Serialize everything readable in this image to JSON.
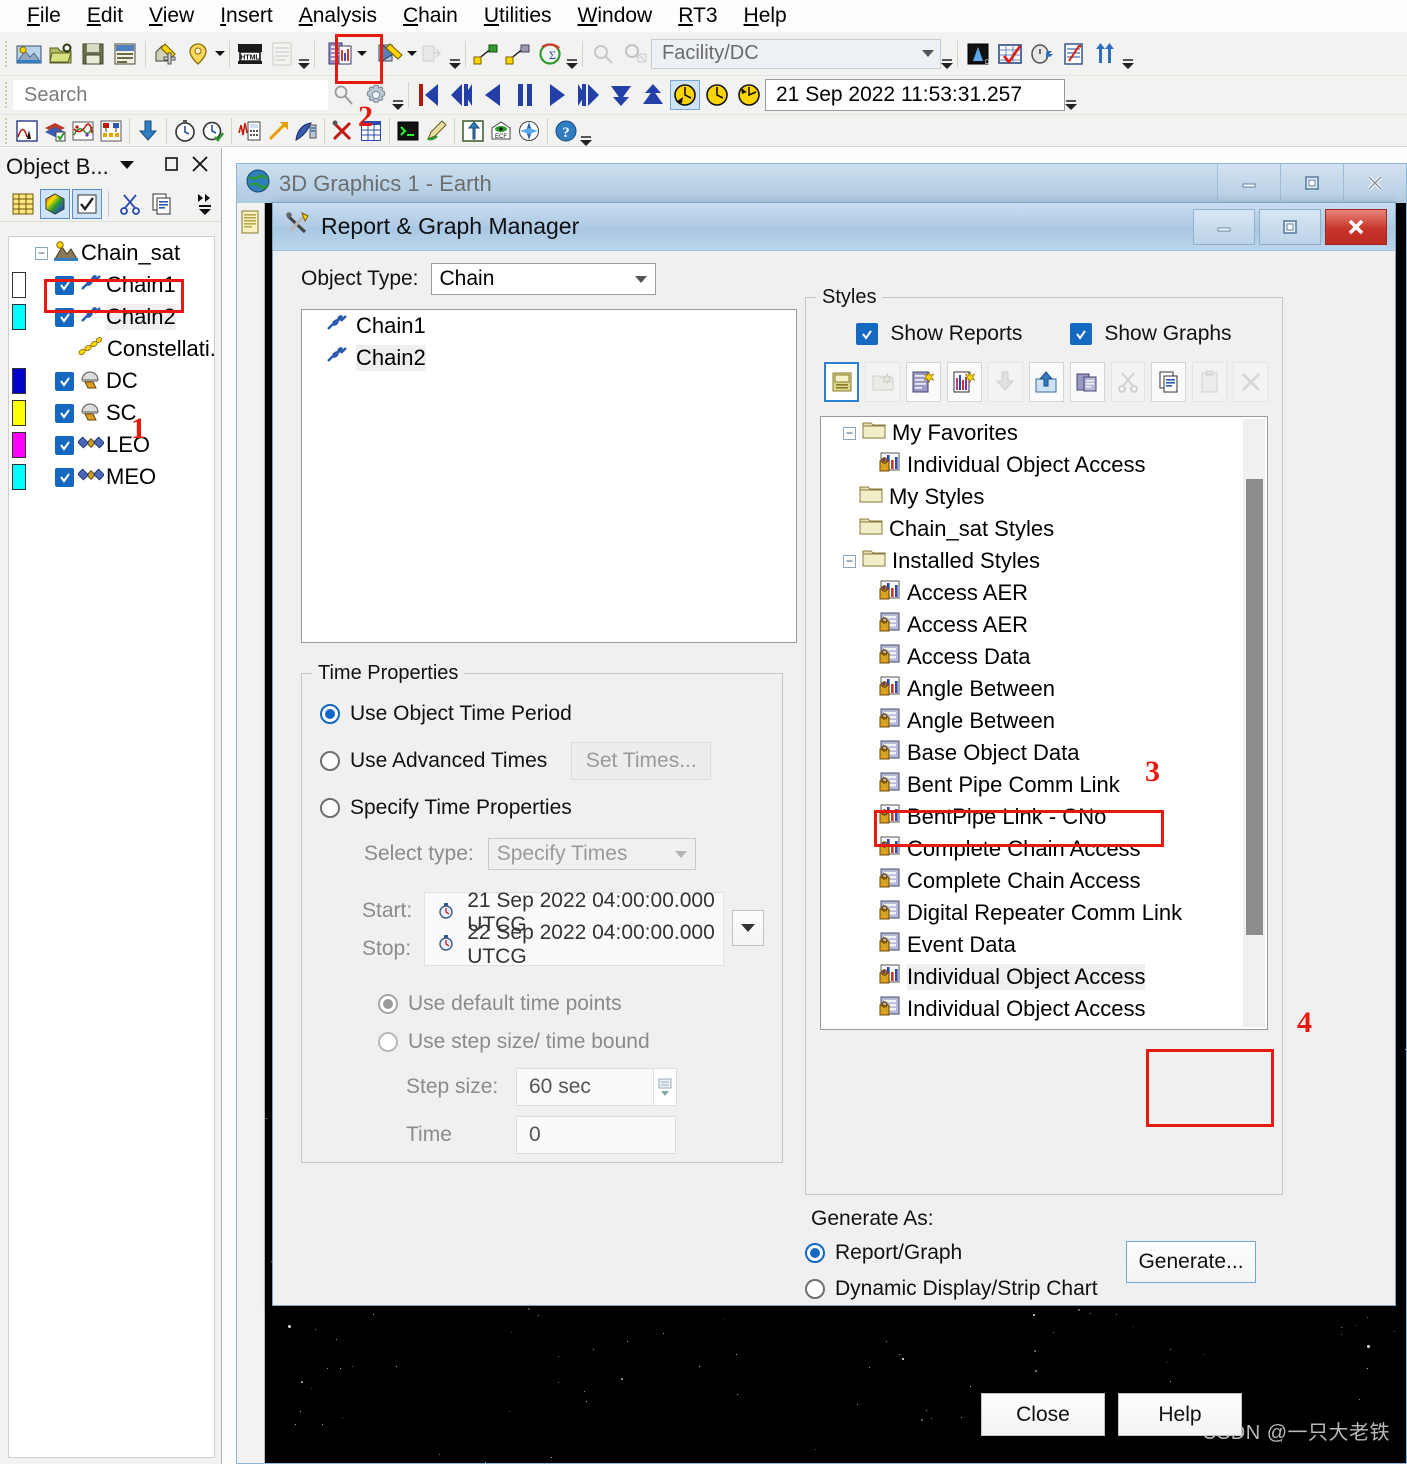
{
  "menubar": {
    "items": [
      {
        "label": "File",
        "accel": "F"
      },
      {
        "label": "Edit",
        "accel": "E"
      },
      {
        "label": "View",
        "accel": "V"
      },
      {
        "label": "Insert",
        "accel": "I"
      },
      {
        "label": "Analysis",
        "accel": "A"
      },
      {
        "label": "Chain",
        "accel": "C"
      },
      {
        "label": "Utilities",
        "accel": "U"
      },
      {
        "label": "Window",
        "accel": "W"
      },
      {
        "label": "RT3",
        "accel": "R"
      },
      {
        "label": "Help",
        "accel": "H"
      }
    ]
  },
  "toolbar": {
    "search_placeholder": "Search",
    "facility_combo_value": "Facility/DC",
    "time_value": "21 Sep 2022 11:53:31.257",
    "annotation_2": "2"
  },
  "object_browser": {
    "title": "Object B...",
    "tree": [
      {
        "label": "Chain_sat",
        "indent": 0,
        "checkbox": false,
        "icon": "scenario-icon",
        "swatch": null,
        "expander": "-"
      },
      {
        "label": "Chain1",
        "indent": 1,
        "checkbox": true,
        "icon": "chain-icon",
        "swatch": "#ffffff",
        "highlight": false
      },
      {
        "label": "Chain2",
        "indent": 1,
        "checkbox": true,
        "icon": "chain-icon",
        "swatch": "#00ffff",
        "highlight": true
      },
      {
        "label": "Constellati...",
        "indent": 1,
        "checkbox": false,
        "icon": "constellation-icon",
        "swatch": null
      },
      {
        "label": "DC",
        "indent": 1,
        "checkbox": true,
        "icon": "facility-icon",
        "swatch": "#0000cc"
      },
      {
        "label": "SC",
        "indent": 1,
        "checkbox": true,
        "icon": "facility-icon",
        "swatch": "#ffff00"
      },
      {
        "label": "LEO",
        "indent": 1,
        "checkbox": true,
        "icon": "satellite-icon",
        "swatch": "#ff00ff"
      },
      {
        "label": "MEO",
        "indent": 1,
        "checkbox": true,
        "icon": "satellite-icon",
        "swatch": "#00ffff"
      }
    ],
    "annotation_1": "1"
  },
  "graphics_window": {
    "title": "3D Graphics 1 - Earth",
    "watermark": "CSDN @一只大老铁"
  },
  "dialog": {
    "title": "Report & Graph Manager",
    "object_type_label": "Object Type:",
    "object_type_value": "Chain",
    "object_list": [
      {
        "label": "Chain1",
        "selected": false
      },
      {
        "label": "Chain2",
        "selected": true
      }
    ],
    "time_properties": {
      "legend": "Time Properties",
      "use_object_time_period": "Use Object Time Period",
      "use_advanced_times": "Use Advanced Times",
      "set_times_button": "Set Times...",
      "specify_time_properties": "Specify Time Properties",
      "select_type_label": "Select type:",
      "select_type_value": "Specify Times",
      "start_label": "Start:",
      "start_value": "21 Sep 2022 04:00:00.000 UTCG",
      "stop_label": "Stop:",
      "stop_value": "22 Sep 2022 04:00:00.000 UTCG",
      "use_default_time_points": "Use default time points",
      "use_step_size": "Use step size/ time bound",
      "step_size_label": "Step size:",
      "step_size_value": "60 sec",
      "time_label": "Time",
      "time_value": "0",
      "selected_radio": "use_object_time_period",
      "selected_points_radio": "use_default_time_points"
    },
    "styles": {
      "legend": "Styles",
      "show_reports": "Show Reports",
      "show_graphs": "Show Graphs",
      "show_reports_checked": true,
      "show_graphs_checked": true,
      "toolbar_icons": [
        {
          "name": "save-style-icon",
          "enabled": true,
          "active": true
        },
        {
          "name": "new-folder-icon",
          "enabled": false,
          "active": false
        },
        {
          "name": "new-report-style-icon",
          "enabled": true,
          "active": false
        },
        {
          "name": "new-graph-style-icon",
          "enabled": true,
          "active": false
        },
        {
          "name": "import-style-icon",
          "enabled": false,
          "active": false
        },
        {
          "name": "export-style-icon",
          "enabled": true,
          "active": false
        },
        {
          "name": "duplicate-style-icon",
          "enabled": true,
          "active": false
        },
        {
          "name": "cut-icon",
          "enabled": false,
          "active": false
        },
        {
          "name": "copy-icon",
          "enabled": true,
          "active": false
        },
        {
          "name": "paste-icon",
          "enabled": false,
          "active": false
        },
        {
          "name": "delete-icon",
          "enabled": false,
          "active": false
        }
      ],
      "tree": [
        {
          "label": "My Favorites",
          "type": "folder",
          "indent": 0,
          "expander": "-"
        },
        {
          "label": "Individual Object Access",
          "type": "graph",
          "indent": 1
        },
        {
          "label": "My Styles",
          "type": "folder",
          "indent": 0
        },
        {
          "label": "Chain_sat Styles",
          "type": "folder",
          "indent": 0
        },
        {
          "label": "Installed Styles",
          "type": "folder",
          "indent": 0,
          "expander": "-"
        },
        {
          "label": "Access AER",
          "type": "graph",
          "indent": 1
        },
        {
          "label": "Access AER",
          "type": "report",
          "indent": 1
        },
        {
          "label": "Access Data",
          "type": "report",
          "indent": 1
        },
        {
          "label": "Angle Between",
          "type": "graph",
          "indent": 1
        },
        {
          "label": "Angle Between",
          "type": "report",
          "indent": 1
        },
        {
          "label": "Base Object Data",
          "type": "report",
          "indent": 1
        },
        {
          "label": "Bent Pipe Comm Link",
          "type": "report",
          "indent": 1
        },
        {
          "label": "BentPipe Link - CNo",
          "type": "graph",
          "indent": 1
        },
        {
          "label": "Complete Chain Access",
          "type": "graph",
          "indent": 1,
          "outlined": true
        },
        {
          "label": "Complete Chain Access",
          "type": "report",
          "indent": 1
        },
        {
          "label": "Digital Repeater Comm Link",
          "type": "report",
          "indent": 1
        },
        {
          "label": "Event Data",
          "type": "report",
          "indent": 1
        },
        {
          "label": "Individual Object Access",
          "type": "graph",
          "indent": 1,
          "highlight": true
        },
        {
          "label": "Individual Object Access",
          "type": "report",
          "indent": 1
        }
      ],
      "annotation_3": "3"
    },
    "generate_as": {
      "label": "Generate As:",
      "report_graph": "Report/Graph",
      "dynamic_display": "Dynamic Display/Strip Chart",
      "selected": "report_graph",
      "generate_button": "Generate...",
      "annotation_4": "4"
    },
    "close_button": "Close",
    "help_button": "Help"
  },
  "colors": {
    "accent": "#1669c1",
    "annotation_red": "#e8190f",
    "title_blue": "#b2cde6",
    "dialog_bg": "#f0f0f0"
  }
}
